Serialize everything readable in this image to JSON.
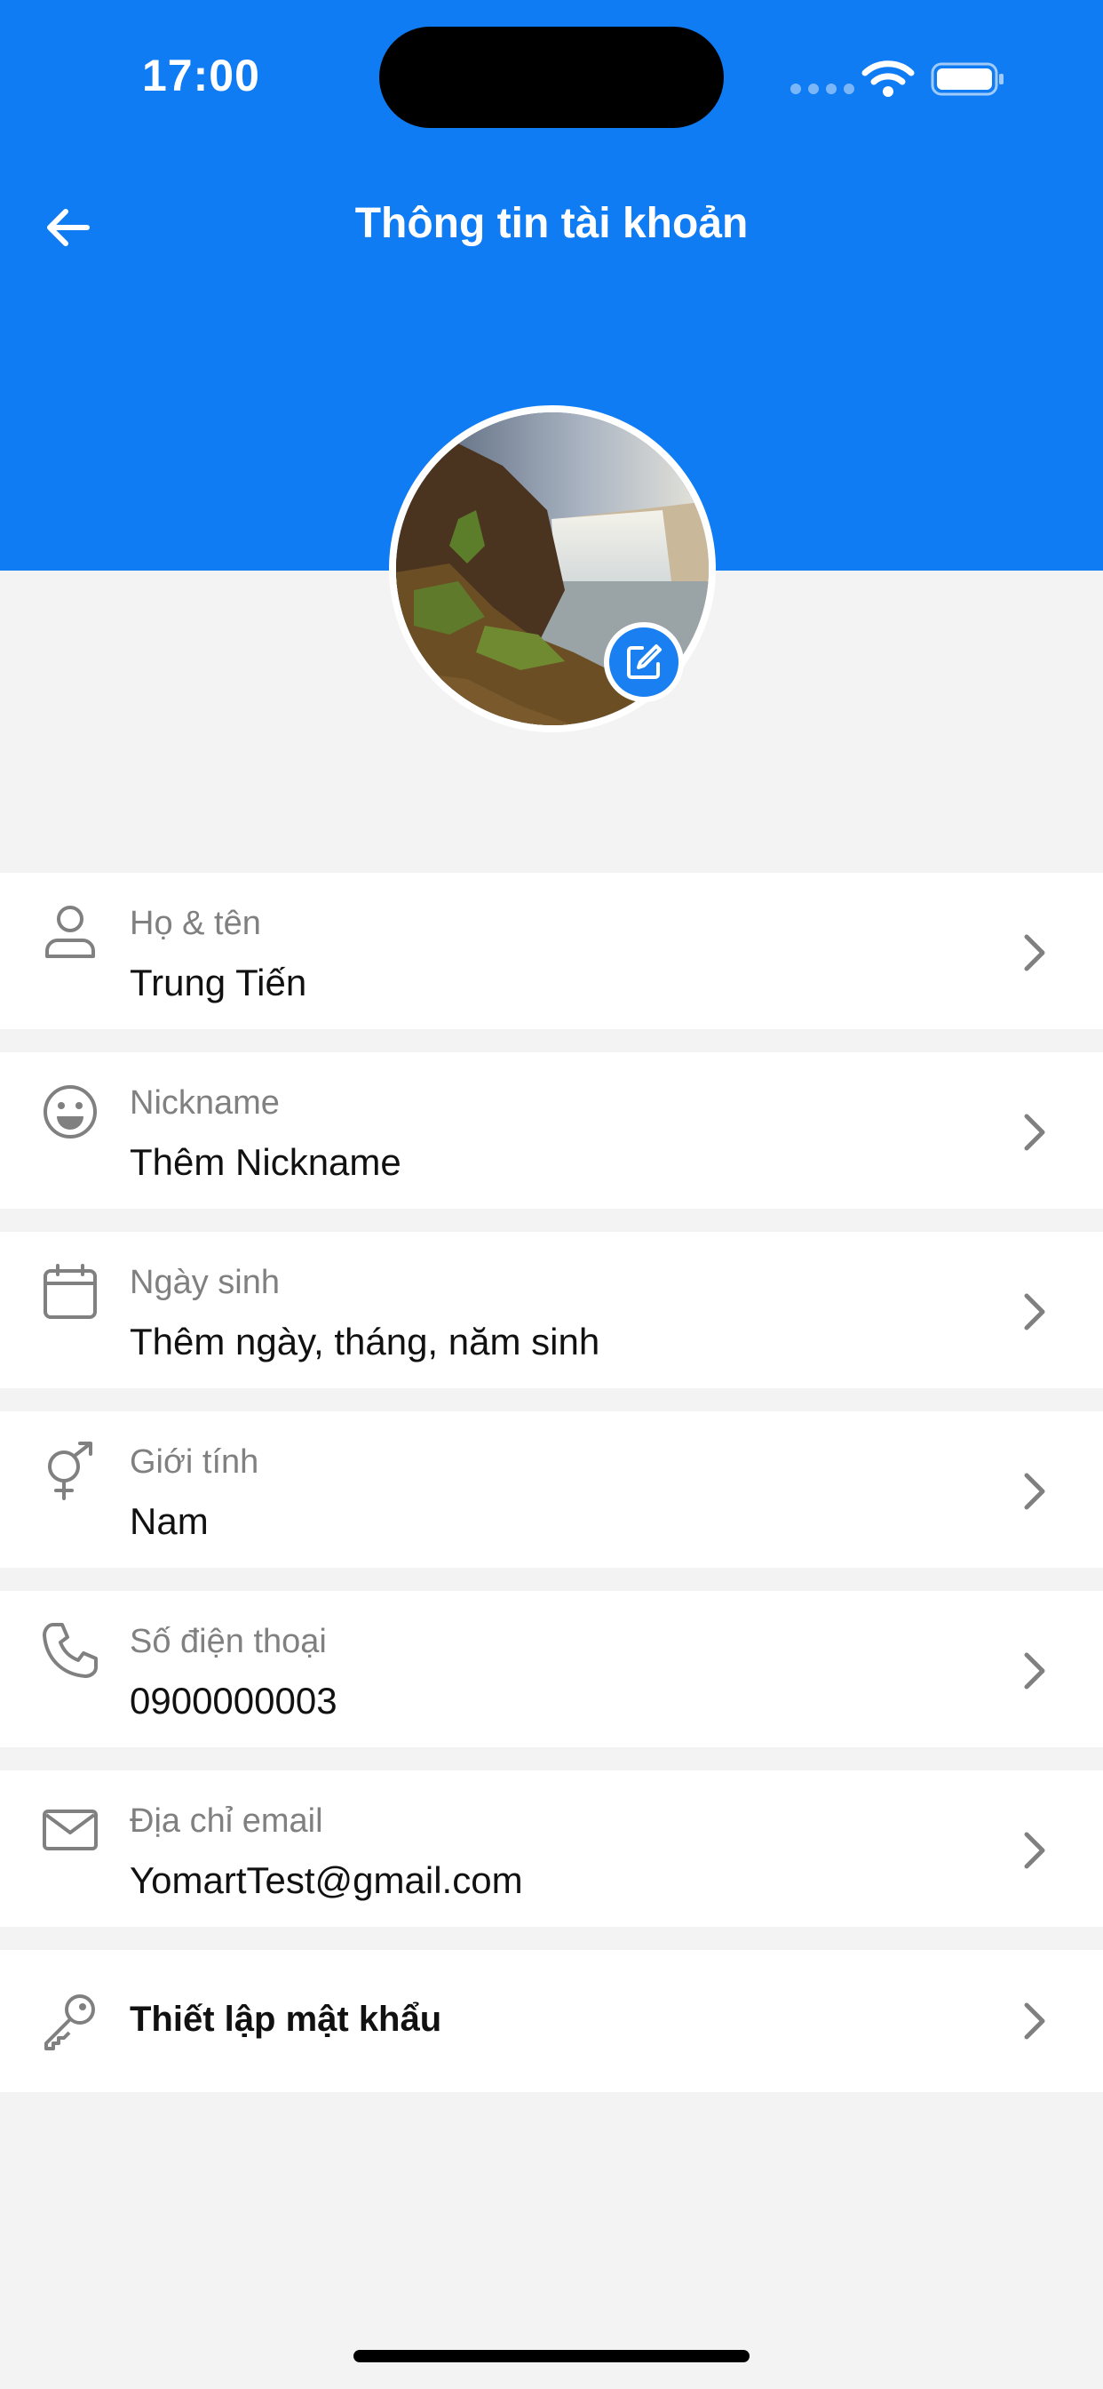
{
  "status_bar": {
    "time": "17:00"
  },
  "header": {
    "title": "Thông tin tài khoản"
  },
  "colors": {
    "accent": "#0f7cf3",
    "label": "#808080",
    "background": "#f3f3f3"
  },
  "avatar": {
    "icon": "avatar-photo",
    "edit_icon": "edit-icon"
  },
  "rows": [
    {
      "icon": "person-icon",
      "label": "Họ & tên",
      "value": "Trung Tiến"
    },
    {
      "icon": "smile-icon",
      "label": "Nickname",
      "value": "Thêm Nickname"
    },
    {
      "icon": "calendar-icon",
      "label": "Ngày sinh",
      "value": "Thêm ngày, tháng, năm sinh"
    },
    {
      "icon": "gender-icon",
      "label": "Giới tính",
      "value": "Nam"
    },
    {
      "icon": "phone-icon",
      "label": "Số điện thoại",
      "value": "0900000003"
    },
    {
      "icon": "mail-icon",
      "label": "Địa chỉ email",
      "value": "YomartTest@gmail.com"
    },
    {
      "icon": "key-icon",
      "label": "",
      "value": "Thiết lập mật khẩu"
    }
  ]
}
